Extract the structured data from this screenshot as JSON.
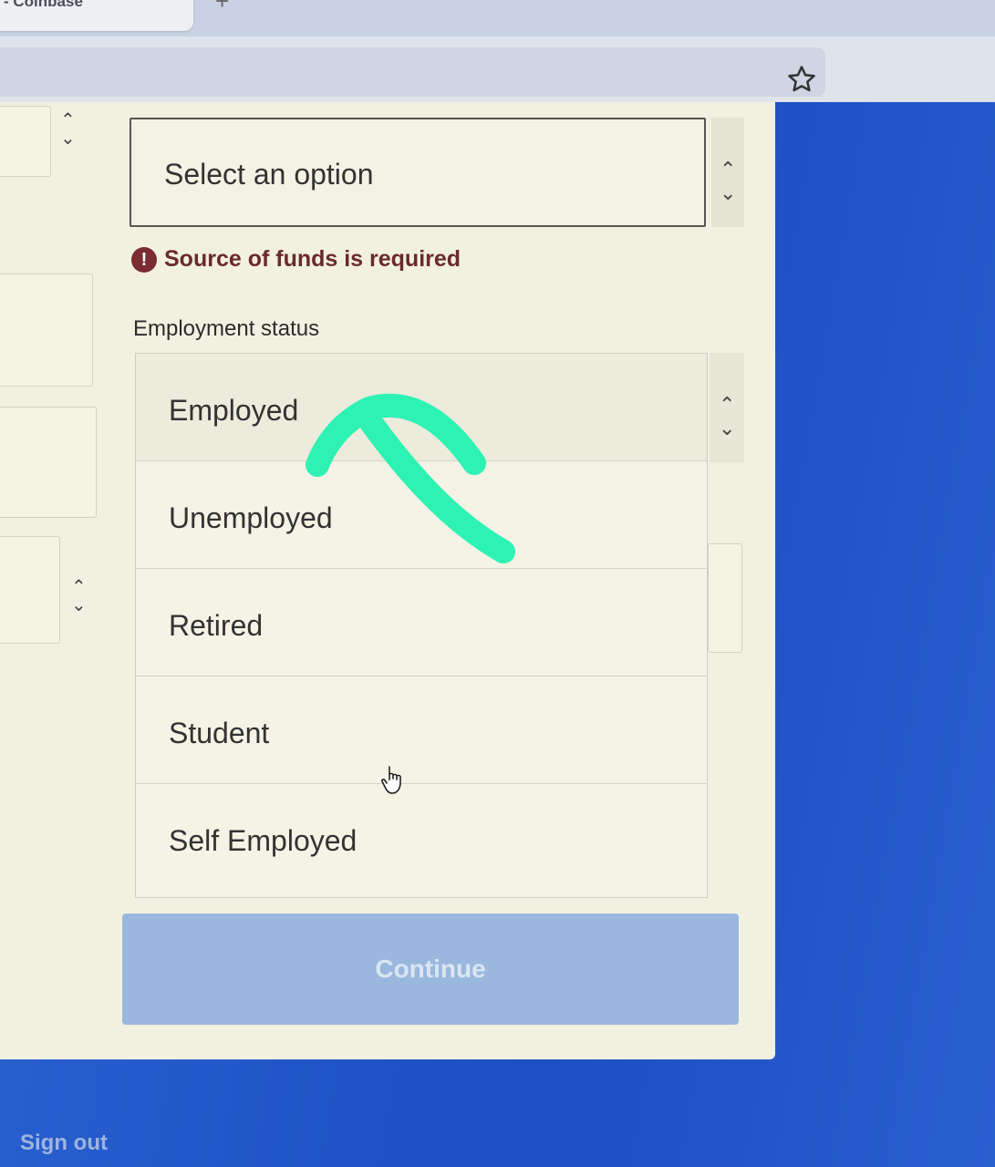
{
  "browser": {
    "tab_title": "- Coinbase",
    "tab_close": "×",
    "new_tab": "+"
  },
  "form": {
    "source_of_funds": {
      "placeholder": "Select an option",
      "error": "Source of funds is required"
    },
    "employment": {
      "label": "Employment status",
      "options": [
        "Employed",
        "Unemployed",
        "Retired",
        "Student",
        "Self Employed"
      ],
      "selected": "Employed"
    },
    "continue_label": "Continue"
  },
  "sidebar": {
    "sign_out": "Sign out"
  },
  "annotation": {
    "color": "#2ef2b4",
    "shape": "arrow-up-left"
  },
  "colors": {
    "page_bg": "#1f57c9",
    "modal_bg": "#f2f1e1",
    "error": "#6a2a2d",
    "button": "#9ab8de"
  }
}
